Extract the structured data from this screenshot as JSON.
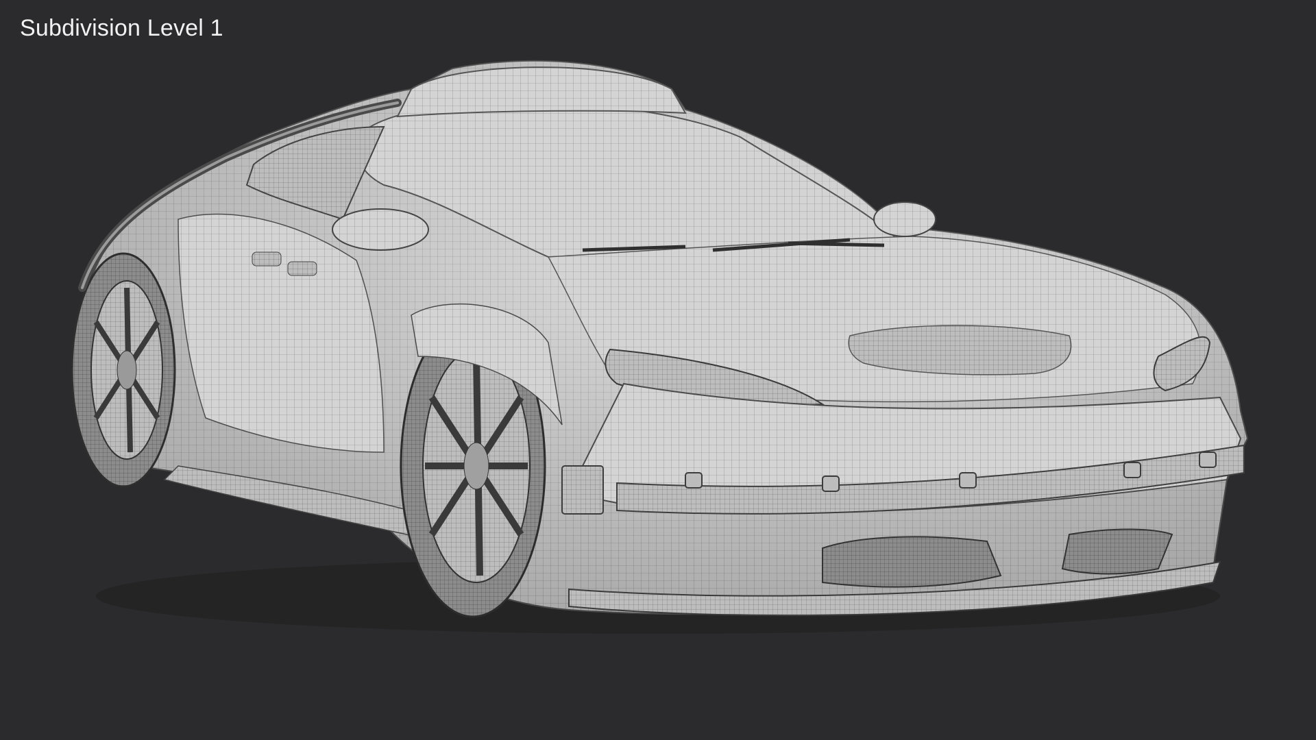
{
  "viewport": {
    "label": "Subdivision Level 1",
    "background_color": "#2b2b2d",
    "label_color": "#f2f2f2"
  },
  "render": {
    "subject": "car-wireframe-render",
    "surface_color": "#d9d9d9",
    "wire_color": "#5a5a5a"
  }
}
